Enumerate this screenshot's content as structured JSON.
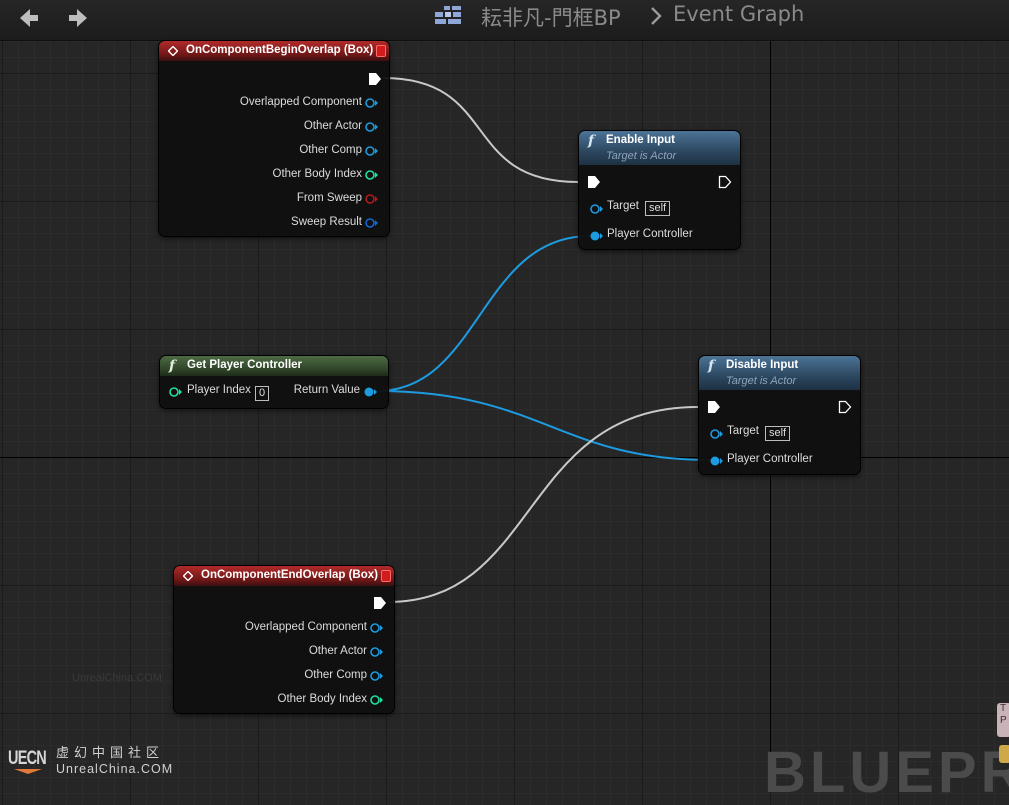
{
  "toolbar": {
    "back_icon": "back-arrow-icon",
    "forward_icon": "forward-arrow-icon",
    "blueprint_icon": "blueprint-icon",
    "breadcrumb_blueprint": "耘非凡-門框BP",
    "breadcrumb_separator_icon": "chevron-right-icon",
    "breadcrumb_graph": "Event Graph"
  },
  "nodes": {
    "begin_overlap": {
      "title": "OnComponentBeginOverlap (Box)",
      "pins": {
        "overlapped_component": "Overlapped Component",
        "other_actor": "Other Actor",
        "other_comp": "Other Comp",
        "other_body_index": "Other Body Index",
        "from_sweep": "From Sweep",
        "sweep_result": "Sweep Result"
      }
    },
    "enable_input": {
      "title": "Enable Input",
      "subtitle": "Target is Actor",
      "pins": {
        "target": "Target",
        "target_value": "self",
        "player_controller": "Player Controller"
      }
    },
    "get_player_controller": {
      "title": "Get Player Controller",
      "pins": {
        "player_index": "Player Index",
        "player_index_value": "0",
        "return_value": "Return Value"
      }
    },
    "disable_input": {
      "title": "Disable Input",
      "subtitle": "Target is Actor",
      "pins": {
        "target": "Target",
        "target_value": "self",
        "player_controller": "Player Controller"
      }
    },
    "end_overlap": {
      "title": "OnComponentEndOverlap (Box)",
      "pins": {
        "overlapped_component": "Overlapped Component",
        "other_actor": "Other Actor",
        "other_comp": "Other Comp",
        "other_body_index": "Other Body Index"
      }
    }
  },
  "colors": {
    "exec_wire": "#c8c8c8",
    "object_pin": "#1d9be0",
    "int_pin": "#1fe2a0",
    "bool_pin": "#a10000",
    "struct_pin": "#0059cb",
    "event_header": "#a52222",
    "pure_function_header": "#3e5a36",
    "function_header": "#3a5d7e"
  },
  "watermark": {
    "small": "UnrealChina.COM",
    "logo_text": "UECN",
    "cn": "虚幻中国社区",
    "en": "UnrealChina.COM",
    "corner_mode": "BLUEPR",
    "edge_tab": "T P"
  }
}
